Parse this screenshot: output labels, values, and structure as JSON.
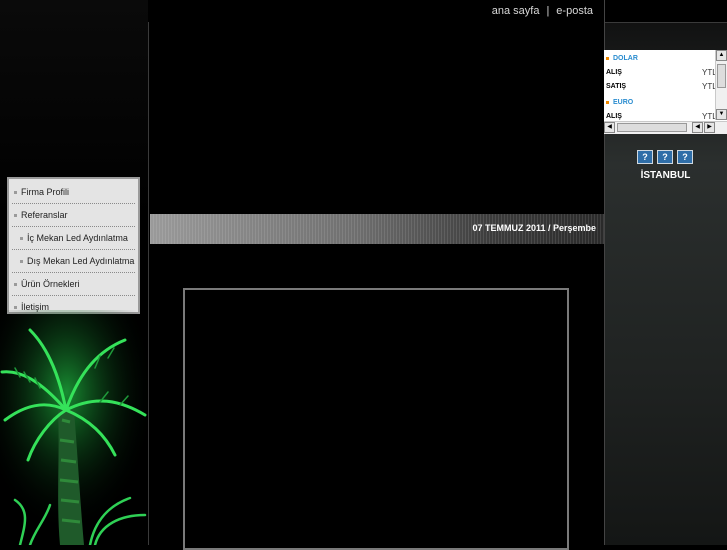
{
  "top_nav": {
    "home_label": "ana sayfa",
    "separator": "|",
    "email_label": "e-posta"
  },
  "date_bar": {
    "text": "07 TEMMUZ 2011 / Perşembe"
  },
  "side_menu": {
    "items": [
      {
        "label": "Firma Profili"
      },
      {
        "label": "Referanslar"
      },
      {
        "label": "İç Mekan Led Aydınlatma"
      },
      {
        "label": "Dış Mekan Led Aydınlatma"
      },
      {
        "label": "Ürün Örnekleri"
      },
      {
        "label": "İletişim"
      }
    ]
  },
  "currency": {
    "dollar_label": "DOLAR",
    "euro_label": "EURO",
    "rows": [
      {
        "label": "ALIŞ",
        "value": "YTL"
      },
      {
        "label": "SATIŞ",
        "value": "YTL"
      },
      {
        "label": "ALIŞ",
        "value": "YTL"
      }
    ]
  },
  "weather": {
    "icons": [
      "?",
      "?",
      "?"
    ],
    "city": "İSTANBUL"
  },
  "colors": {
    "menu_bg": "#e4e4e4",
    "currency_accent": "#2a8ccf",
    "bullet_orange": "#f08a00",
    "weather_icon_bg": "#2f6ea8"
  }
}
